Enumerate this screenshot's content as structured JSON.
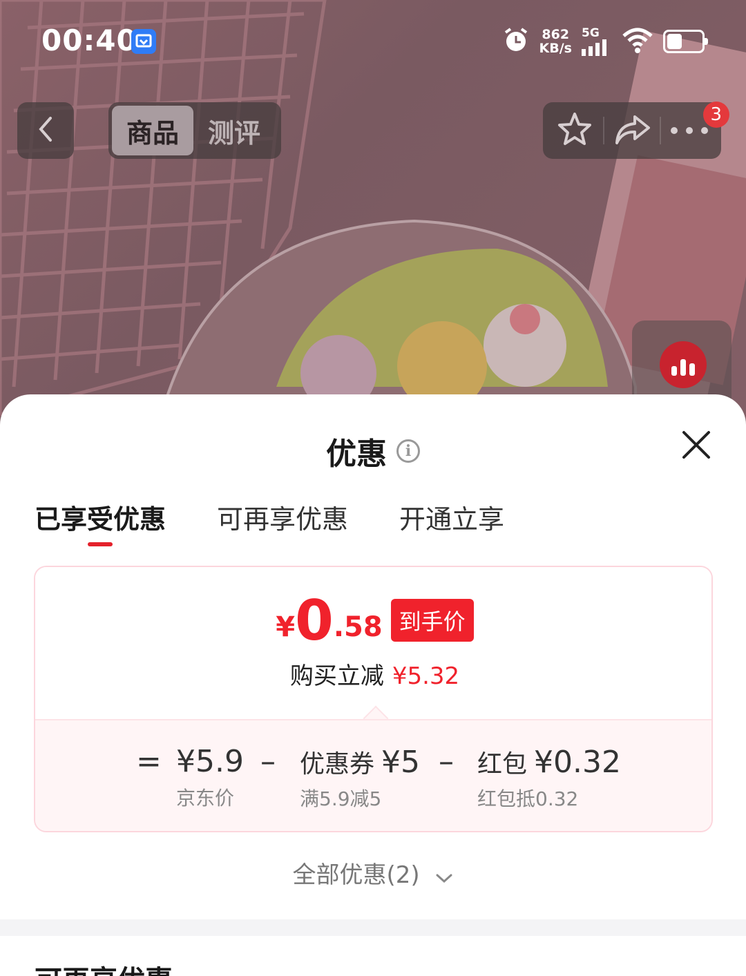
{
  "status_bar": {
    "time": "00:40",
    "net_speed_value": "862",
    "net_speed_unit": "KB/s",
    "network": "5G",
    "battery_level": 0.5
  },
  "nav": {
    "tabs": [
      {
        "label": "商品",
        "active": true
      },
      {
        "label": "测评",
        "active": false
      }
    ],
    "more_badge": "3"
  },
  "sheet": {
    "title": "优惠",
    "tabs": [
      {
        "label": "已享受优惠",
        "active": true
      },
      {
        "label": "可再享优惠",
        "active": false
      },
      {
        "label": "开通立享",
        "active": false
      }
    ],
    "final_price": {
      "yen": "¥",
      "integer": "0",
      "decimal": ".58",
      "tag": "到手价"
    },
    "save": {
      "label": "购买立减",
      "amount": "¥5.32"
    },
    "breakdown": {
      "equals": "=",
      "minus": "–",
      "jd_price": {
        "value": "¥5.9",
        "sub": "京东价"
      },
      "coupon": {
        "label": "优惠券",
        "value": "¥5",
        "sub": "满5.9减5"
      },
      "redpacket": {
        "label": "红包",
        "value": "¥0.32",
        "sub": "红包抵0.32"
      }
    },
    "all_offers": "全部优惠(2)",
    "next_section_title": "可再享优惠"
  },
  "colors": {
    "accent_red": "#f0222c",
    "card_border": "#fcd6dd",
    "card_bottom_bg": "#fff5f6"
  }
}
